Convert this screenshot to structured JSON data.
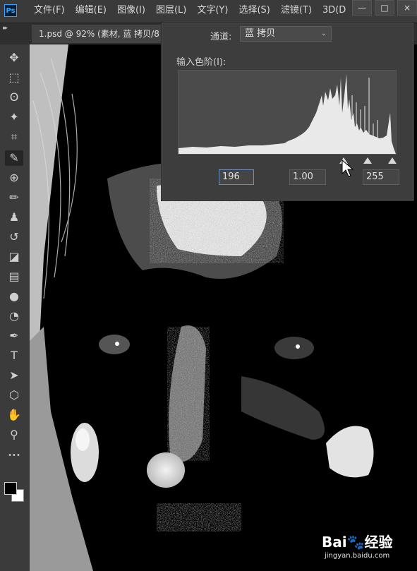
{
  "app": {
    "logo_text": "Ps",
    "menu": [
      "文件(F)",
      "编辑(E)",
      "图像(I)",
      "图层(L)",
      "文字(Y)",
      "选择(S)",
      "滤镜(T)",
      "3D(D"
    ],
    "window_controls": [
      "—",
      "□",
      "×"
    ]
  },
  "tabbar": {
    "collapse_glyph": "▸▸",
    "document_tab": "1.psd @ 92% (素材, 蓝 拷贝/8"
  },
  "toolbar": {
    "tools": [
      {
        "name": "move-tool",
        "glyph": "✥"
      },
      {
        "name": "marquee-tool",
        "glyph": "⬚"
      },
      {
        "name": "lasso-tool",
        "glyph": "ʘ"
      },
      {
        "name": "magic-wand-tool",
        "glyph": "✦"
      },
      {
        "name": "crop-tool",
        "glyph": "⌗"
      },
      {
        "name": "eyedropper-tool",
        "glyph": "✎"
      },
      {
        "name": "healing-brush-tool",
        "glyph": "⊕"
      },
      {
        "name": "brush-tool",
        "glyph": "✏"
      },
      {
        "name": "stamp-tool",
        "glyph": "♟"
      },
      {
        "name": "history-brush-tool",
        "glyph": "↺"
      },
      {
        "name": "eraser-tool",
        "glyph": "◪"
      },
      {
        "name": "gradient-tool",
        "glyph": "▤"
      },
      {
        "name": "blur-tool",
        "glyph": "●"
      },
      {
        "name": "dodge-tool",
        "glyph": "◔"
      },
      {
        "name": "pen-tool",
        "glyph": "✒"
      },
      {
        "name": "type-tool",
        "glyph": "T"
      },
      {
        "name": "path-selection-tool",
        "glyph": "➤"
      },
      {
        "name": "shape-tool",
        "glyph": "⬡"
      },
      {
        "name": "hand-tool",
        "glyph": "✋"
      },
      {
        "name": "zoom-tool",
        "glyph": "⚲"
      },
      {
        "name": "more-tools",
        "glyph": "•••"
      }
    ],
    "foreground_color": "#000000",
    "background_color": "#ffffff"
  },
  "levels_panel": {
    "channel_label": "通道:",
    "channel_value": "蓝 拷贝",
    "input_levels_label": "输入色阶(I):",
    "black_point": "196",
    "gamma": "1.00",
    "white_point": "255",
    "black_level": 196,
    "gamma_level": 225,
    "white_level": 255
  },
  "watermark": {
    "brand": "Bai🐾经验",
    "url": "jingyan.baidu.com"
  }
}
